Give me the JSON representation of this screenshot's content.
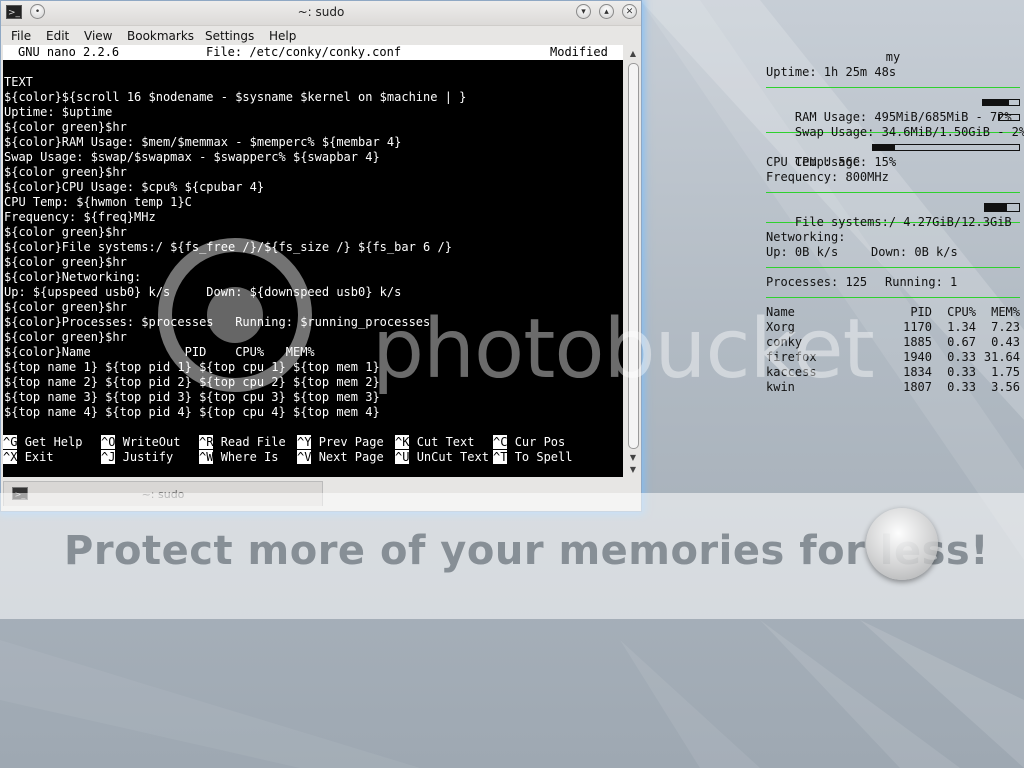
{
  "window": {
    "title": "~: sudo",
    "menu": [
      "File",
      "Edit",
      "View",
      "Bookmarks",
      "Settings",
      "Help"
    ],
    "tab_label": "~: sudo"
  },
  "nano": {
    "version": "GNU nano 2.2.6",
    "file": "File: /etc/conky/conky.conf",
    "status": "Modified",
    "lines": [
      "TEXT",
      "${color}${scroll 16 $nodename - $sysname $kernel on $machine | }",
      "Uptime: $uptime",
      "${color green}$hr",
      "${color}RAM Usage: $mem/$memmax - $memperc% ${membar 4}",
      "Swap Usage: $swap/$swapmax - $swapperc% ${swapbar 4}",
      "${color green}$hr",
      "${color}CPU Usage: $cpu% ${cpubar 4}",
      "CPU Temp: ${hwmon temp 1}C",
      "Frequency: ${freq}MHz",
      "${color green}$hr",
      "${color}File systems:/ ${fs_free /}/${fs_size /} ${fs_bar 6 /}",
      "${color green}$hr",
      "${color}Networking:",
      "Up: ${upspeed usb0} k/s     Down: ${downspeed usb0} k/s",
      "${color green}$hr",
      "${color}Processes: $processes   Running: $running_processes",
      "${color green}$hr",
      "${color}Name             PID    CPU%   MEM%",
      "${top name 1} ${top pid 1} ${top cpu 1} ${top mem 1}",
      "${top name 2} ${top pid 2} ${top cpu 2} ${top mem 2}",
      "${top name 3} ${top pid 3} ${top cpu 3} ${top mem 3}",
      "${top name 4} ${top pid 4} ${top cpu 4} ${top mem 4}"
    ],
    "shortcuts": [
      {
        "key": "^G",
        "label": "Get Help"
      },
      {
        "key": "^O",
        "label": "WriteOut"
      },
      {
        "key": "^R",
        "label": "Read File"
      },
      {
        "key": "^Y",
        "label": "Prev Page"
      },
      {
        "key": "^K",
        "label": "Cut Text"
      },
      {
        "key": "^C",
        "label": "Cur Pos"
      },
      {
        "key": "^X",
        "label": "Exit"
      },
      {
        "key": "^J",
        "label": "Justify"
      },
      {
        "key": "^W",
        "label": "Where Is"
      },
      {
        "key": "^V",
        "label": "Next Page"
      },
      {
        "key": "^U",
        "label": "UnCut Text"
      },
      {
        "key": "^T",
        "label": "To Spell"
      }
    ]
  },
  "conky": {
    "scroll": "my",
    "uptime": "Uptime: 1h 25m 48s",
    "ram": "RAM Usage: 495MiB/685MiB - 72%",
    "ram_fraction": 0.72,
    "swap": "Swap Usage: 34.6MiB/1.50GiB - 2%",
    "swap_fraction": 0.02,
    "cpu": "CPU Usage: 15%",
    "cpu_fraction": 0.15,
    "cpu_temp": "CPU Temp: 56C",
    "frequency": "Frequency: 800MHz",
    "fs": "File systems:/ 4.27GiB/12.3GiB",
    "fs_fraction": 0.65,
    "networking": "Networking:",
    "up": "Up: 0B k/s",
    "down": "Down: 0B k/s",
    "processes": "Processes: 125",
    "running": "Running: 1",
    "header": {
      "name": "Name",
      "pid": "PID",
      "cpu": "CPU%",
      "mem": "MEM%"
    },
    "procs": [
      {
        "name": "Xorg",
        "pid": "1170",
        "cpu": "1.34",
        "mem": "7.23"
      },
      {
        "name": "conky",
        "pid": "1885",
        "cpu": "0.67",
        "mem": "0.43"
      },
      {
        "name": "firefox",
        "pid": "1940",
        "cpu": "0.33",
        "mem": "31.64"
      },
      {
        "name": "kaccess",
        "pid": "1834",
        "cpu": "0.33",
        "mem": "1.75"
      },
      {
        "name": "kwin",
        "pid": "1807",
        "cpu": "0.33",
        "mem": "3.56"
      }
    ]
  },
  "overlay": {
    "watermark": "photobucket",
    "banner": "Protect more of your memories for less!"
  }
}
